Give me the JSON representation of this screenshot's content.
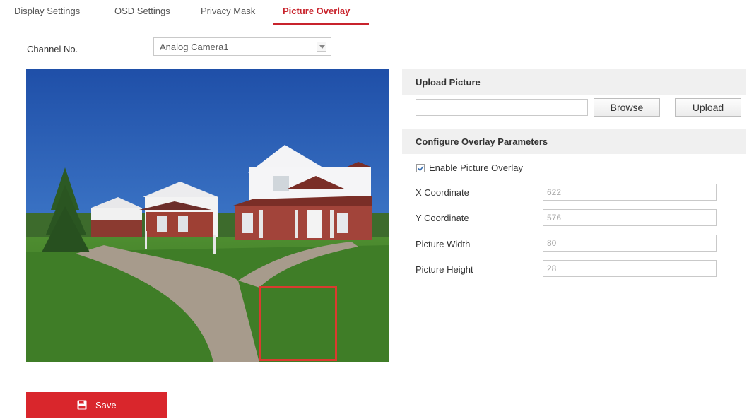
{
  "tabs": [
    {
      "label": "Display Settings",
      "active": false
    },
    {
      "label": "OSD Settings",
      "active": false
    },
    {
      "label": "Privacy Mask",
      "active": false
    },
    {
      "label": "Picture Overlay",
      "active": true
    }
  ],
  "channel": {
    "label": "Channel No.",
    "selected": "Analog Camera1"
  },
  "upload": {
    "section_title": "Upload Picture",
    "file_value": "",
    "browse_label": "Browse",
    "upload_label": "Upload"
  },
  "overlay": {
    "section_title": "Configure Overlay Parameters",
    "enable_label": "Enable Picture Overlay",
    "enabled": true,
    "fields": [
      {
        "label": "X Coordinate",
        "value": "622"
      },
      {
        "label": "Y Coordinate",
        "value": "576"
      },
      {
        "label": "Picture Width",
        "value": "80"
      },
      {
        "label": "Picture Height",
        "value": "28"
      }
    ]
  },
  "save": {
    "label": "Save",
    "icon": "floppy-disk-icon"
  },
  "colors": {
    "accent": "#d9262c",
    "overlay_border": "#d93b2f",
    "section_bg": "#f0f0f0"
  }
}
